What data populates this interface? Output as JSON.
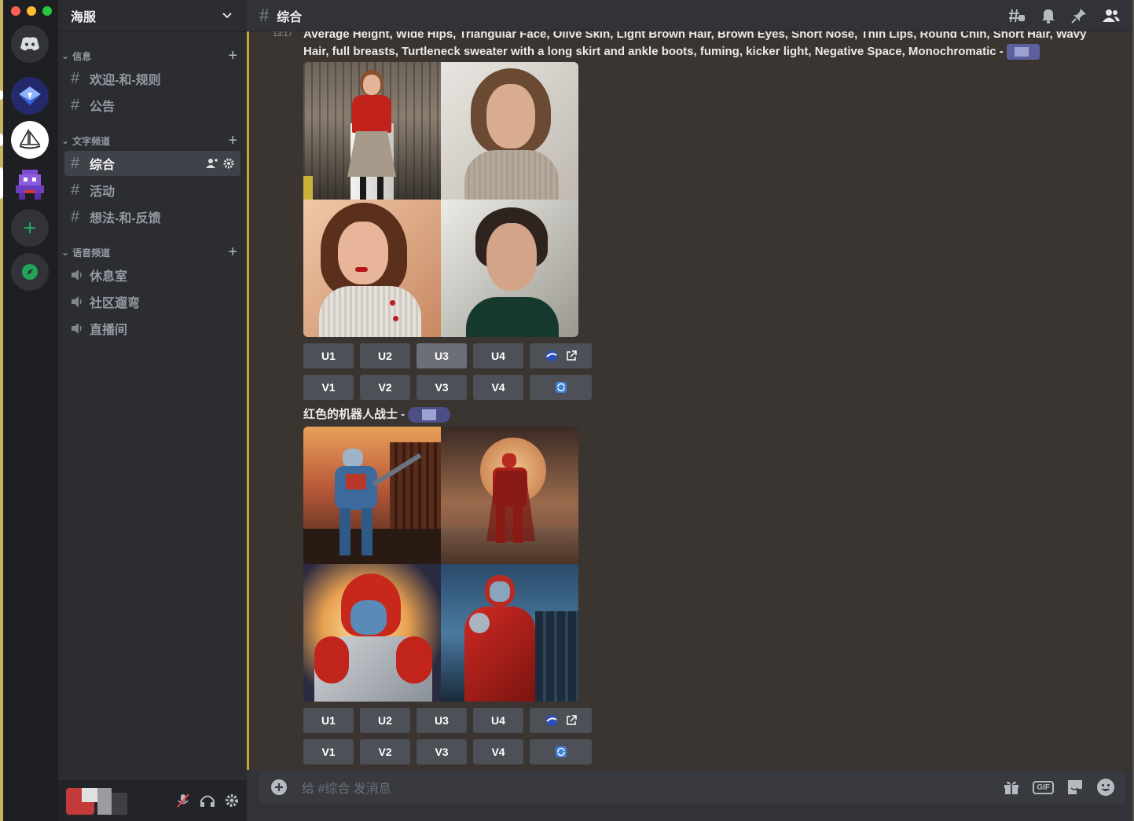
{
  "colors": {
    "accent": "#5865f2",
    "green": "#23a559",
    "bg": "#313338",
    "highlight": "#c8a63c"
  },
  "guild": {
    "name": "海服"
  },
  "categories": {
    "info": "信息",
    "text": "文字频道",
    "voice": "语音频道"
  },
  "channels": {
    "info": [
      "欢迎-和-规则",
      "公告"
    ],
    "text": [
      "综合",
      "活动",
      "想法-和-反馈"
    ],
    "voice": [
      "休息室",
      "社区遛弯",
      "直播间"
    ]
  },
  "header": {
    "channel": "综合"
  },
  "messages": [
    {
      "timestamp": "13:17",
      "text_line1": "Average Height, Wide Hips, Triangular Face, Olive Skin, Light Brown Hair, Brown Eyes, Short Nose, Thin Lips, Round Chin, Short Hair, Wavy",
      "text_line2": "Hair, full breasts, Turtleneck sweater with a long skirt and ankle boots, fuming, kicker light, Negative Space, Monochromatic - ",
      "images": [
        "woman-red-sweater-bridge",
        "woman-beige-sweater-bob",
        "woman-white-turtleneck",
        "woman-green-turtleneck"
      ]
    },
    {
      "text": "红色的机器人战士 - ",
      "images": [
        "robot-blue-red-city",
        "robot-red-moon-cape",
        "robot-red-helmet-sun",
        "robot-red-city-night"
      ]
    }
  ],
  "buttons": {
    "u": [
      "U1",
      "U2",
      "U3",
      "U4"
    ],
    "v": [
      "V1",
      "V2",
      "V3",
      "V4"
    ]
  },
  "composer": {
    "placeholder": "给 #综合 发消息",
    "gif": "GIF"
  }
}
